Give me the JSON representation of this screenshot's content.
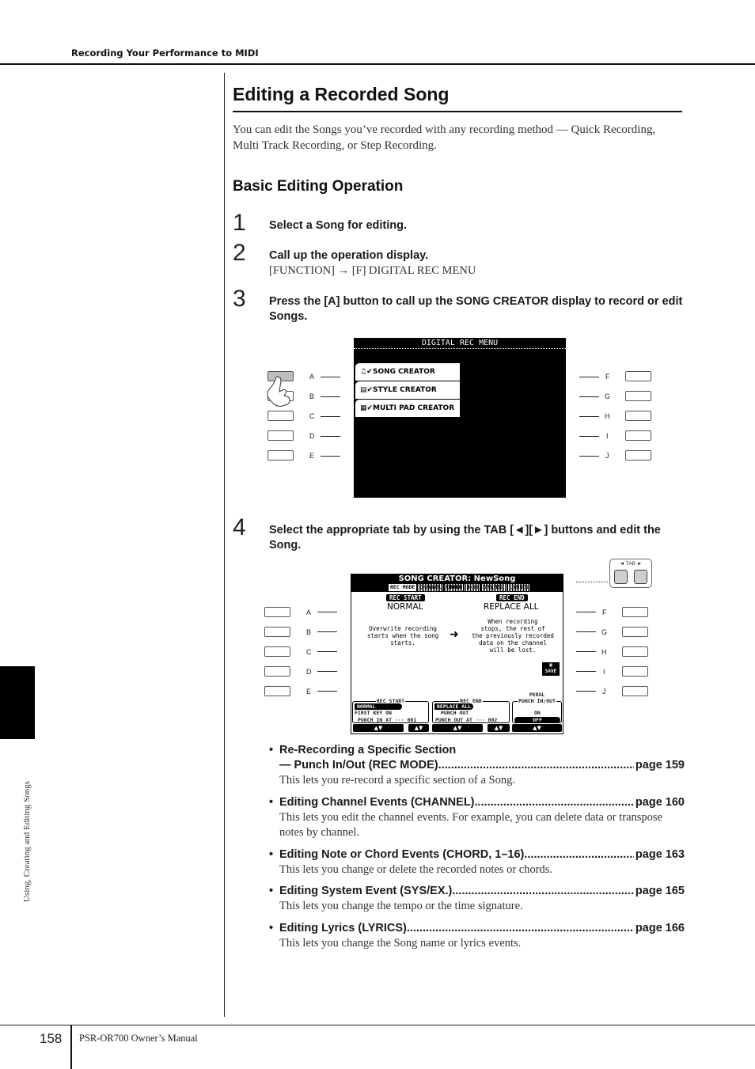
{
  "header": {
    "running_head": "Recording Your Performance to MIDI"
  },
  "section": {
    "title": "Editing a Recorded Song",
    "intro": "You can edit the Songs you’ve recorded with any recording method — Quick Recording, Multi Track Recording, or Step Recording.",
    "subhead": "Basic Editing Operation"
  },
  "steps": [
    {
      "num": "1",
      "text": "Select a Song for editing."
    },
    {
      "num": "2",
      "text": "Call up the operation display.",
      "sub": "[FUNCTION] → [F] DIGITAL REC MENU"
    },
    {
      "num": "3",
      "text": "Press the [A] button to call up the SONG CREATOR display to record or edit Songs."
    },
    {
      "num": "4",
      "text": "Select the appropriate tab by using the TAB [◄][►] buttons and edit the Song."
    }
  ],
  "panel_buttons": {
    "left": [
      "A",
      "B",
      "C",
      "D",
      "E"
    ],
    "right": [
      "F",
      "G",
      "H",
      "I",
      "J"
    ]
  },
  "display1": {
    "title": "DIGITAL REC MENU",
    "items": [
      {
        "icon": "♫✔",
        "label": "SONG CREATOR"
      },
      {
        "icon": "▤✔",
        "label": "STYLE CREATOR"
      },
      {
        "icon": "▦✔",
        "label": "MULTI PAD CREATOR"
      }
    ]
  },
  "display2": {
    "title": "SONG CREATOR: NewSong",
    "tabs": [
      "REC MODE",
      "CHANNEL",
      "CHORD",
      "1–16",
      "SYS/EX.",
      "LYRICS"
    ],
    "active_tab": "REC MODE",
    "rec_start_badge": "REC START",
    "rec_start_value": "NORMAL",
    "rec_start_desc": "Overwrite recording\nstarts when the song\nstarts.",
    "rec_end_badge": "REC END",
    "rec_end_value": "REPLACE ALL",
    "rec_end_desc": "When recording\nstops, the rest of\nthe previously recorded\ndata on the channel\nwill be lost.",
    "arrow": "➜",
    "save_label": "SAVE",
    "box_rec_start": {
      "title": "REC START",
      "options": [
        "NORMAL",
        "FIRST KEY ON",
        "PUNCH IN AT ··· 001"
      ],
      "selected": "NORMAL"
    },
    "box_rec_end": {
      "title": "REC END",
      "options": [
        "REPLACE ALL",
        "PUNCH OUT",
        "PUNCH OUT AT ··· 002"
      ],
      "selected": "REPLACE ALL"
    },
    "box_pedal": {
      "title_line1": "PEDAL",
      "title_line2": "PUNCH IN/OUT",
      "options": [
        "ON",
        "OFF"
      ],
      "selected": "OFF"
    },
    "updown": "▲▼"
  },
  "tab_panel": {
    "label": "◄ TAB ►"
  },
  "bullets": [
    {
      "title_line1": "Re-Recording a Specific Section",
      "title": "— Punch In/Out (REC MODE)",
      "page": "page 159",
      "desc": "This lets you re-record a specific section of a Song."
    },
    {
      "title": "Editing Channel Events (CHANNEL)",
      "page": "page 160",
      "desc": "This lets you edit the channel events. For example, you can delete data or transpose notes by channel."
    },
    {
      "title": "Editing Note or Chord Events (CHORD, 1–16)",
      "page": "page 163",
      "desc": "This lets you change or delete the recorded notes or chords."
    },
    {
      "title": "Editing System Event (SYS/EX.)",
      "page": "page 165",
      "desc": "This lets you change the tempo or the time signature."
    },
    {
      "title": "Editing Lyrics (LYRICS)",
      "page": "page 166",
      "desc": "This lets you change the Song name or lyrics events."
    }
  ],
  "sidebar": {
    "chapter_label": "Using, Creating and Editing Songs"
  },
  "footer": {
    "page_number": "158",
    "manual_name": "PSR-OR700 Owner’s Manual"
  }
}
